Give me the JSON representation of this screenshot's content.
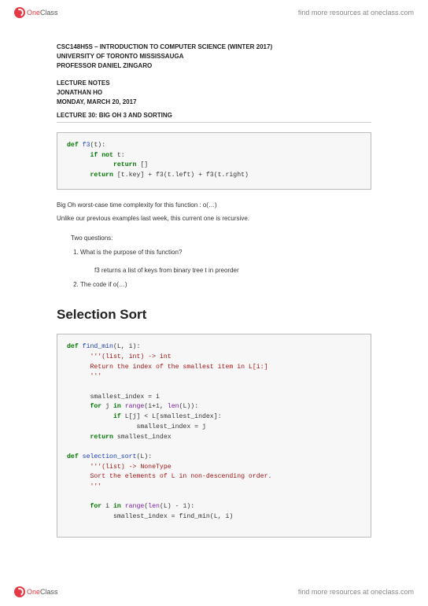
{
  "brand": {
    "logo_one": "One",
    "logo_class": "Class",
    "more": "find more resources at oneclass.com"
  },
  "course": {
    "title": "CSC148H5S – INTRODUCTION TO COMPUTER SCIENCE (WINTER 2017)",
    "university": "UNIVERSITY OF TORONTO MISSISSAUGA",
    "professor": "PROFESSOR DANIEL ZINGARO"
  },
  "notes": {
    "heading": "LECTURE NOTES",
    "author": "JONATHAN HO",
    "date": "MONDAY, MARCH 20, 2017"
  },
  "lecture": {
    "title": "LECTURE 30: BIG OH 3 AND SORTING"
  },
  "code1": {
    "l1a": "def ",
    "l1b": "f3",
    "l1c": "(t):",
    "l2a": "if ",
    "l2b": "not ",
    "l2c": "t:",
    "l3a": "return ",
    "l3b": "[]",
    "l4a": "return ",
    "l4b": "[t.key] + f3(t.left) + f3(t.right)"
  },
  "discussion": {
    "p1": "Big Oh worst-case time complexity for this function : o(…)",
    "p2": "Unlike our previous examples last week, this current one is recursive.",
    "p3": "Two questions:",
    "q1": "What is the purpose of this function?",
    "a1": "f3 returns a list of keys from binary tree t in preorder",
    "q2": "The code if o(…)"
  },
  "section2": {
    "title": "Selection Sort"
  },
  "code2": {
    "fm_l1a": "def ",
    "fm_l1b": "find_min",
    "fm_l1c": "(L, i):",
    "fm_doc1": "'''(list, int) -> int",
    "fm_doc2": "Return the index of the smallest item in L[i:]",
    "fm_doc3": "'''",
    "fm_l2": "smallest_index = i",
    "fm_l3a": "for ",
    "fm_l3b": "j ",
    "fm_l3c": "in ",
    "fm_l3d": "range",
    "fm_l3e": "(i+",
    "fm_l3f": "1",
    "fm_l3g": ", ",
    "fm_l3h": "len",
    "fm_l3i": "(L)):",
    "fm_l4a": "if ",
    "fm_l4b": "L[j] < L[smallest_index]:",
    "fm_l5": "smallest_index = j",
    "fm_l6a": "return ",
    "fm_l6b": "smallest_index",
    "ss_l1a": "def ",
    "ss_l1b": "selection_sort",
    "ss_l1c": "(L):",
    "ss_doc1": "'''(list) -> NoneType",
    "ss_doc2": "Sort the elements of L in non-descending order.",
    "ss_doc3": "'''",
    "ss_l2a": "for ",
    "ss_l2b": "i ",
    "ss_l2c": "in ",
    "ss_l2d": "range",
    "ss_l2e": "(",
    "ss_l2f": "len",
    "ss_l2g": "(L) - ",
    "ss_l2h": "1",
    "ss_l2i": "):",
    "ss_l3": "smallest_index = find_min(L, i)"
  }
}
